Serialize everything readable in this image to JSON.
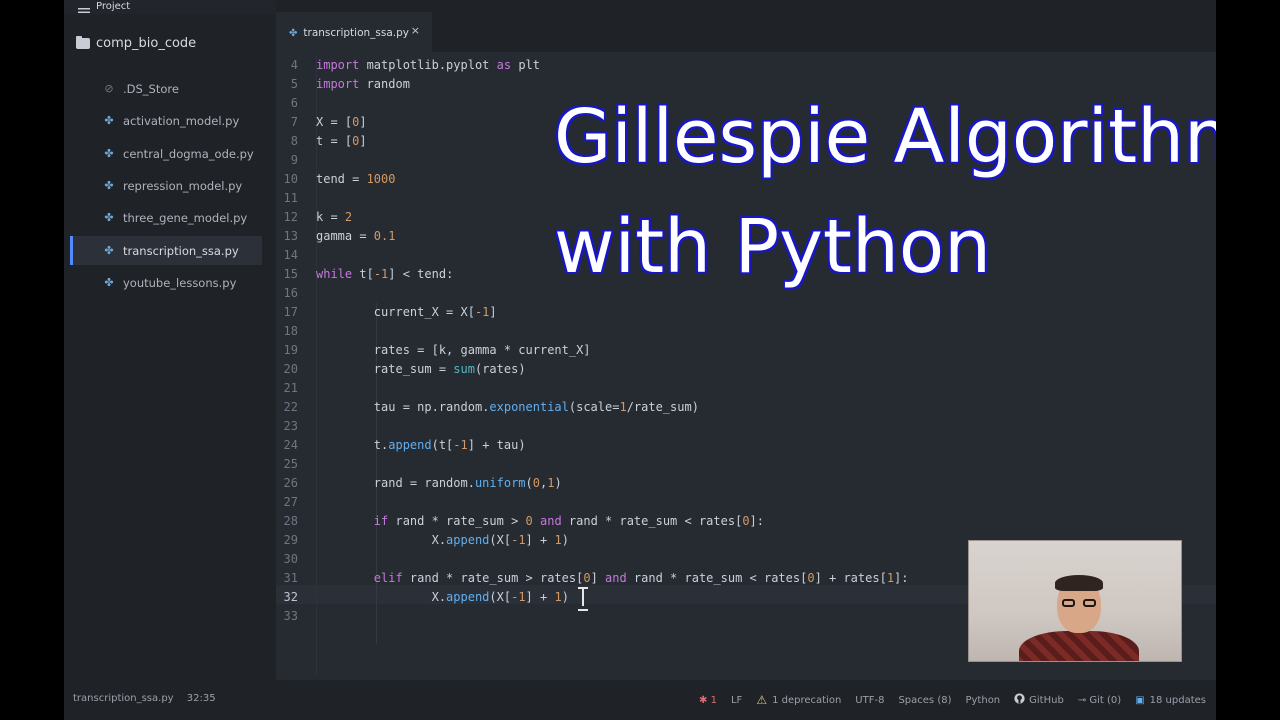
{
  "project_bar": {
    "label": "Project"
  },
  "sidebar": {
    "root": "comp_bio_code",
    "items": [
      {
        "label": ".DS_Store",
        "type": "ds",
        "selected": false
      },
      {
        "label": "activation_model.py",
        "type": "py",
        "selected": false
      },
      {
        "label": "central_dogma_ode.py",
        "type": "py",
        "selected": false
      },
      {
        "label": "repression_model.py",
        "type": "py",
        "selected": false
      },
      {
        "label": "three_gene_model.py",
        "type": "py",
        "selected": false
      },
      {
        "label": "transcription_ssa.py",
        "type": "py",
        "selected": true
      },
      {
        "label": "youtube_lessons.py",
        "type": "py",
        "selected": false
      }
    ]
  },
  "tab": {
    "label": "transcription_ssa.py",
    "close": "×"
  },
  "code": {
    "line_numbers": [
      "4",
      "5",
      "6",
      "7",
      "8",
      "9",
      "10",
      "11",
      "12",
      "13",
      "14",
      "15",
      "16",
      "17",
      "18",
      "19",
      "20",
      "21",
      "22",
      "23",
      "24",
      "25",
      "26",
      "27",
      "28",
      "29",
      "30",
      "31",
      "32",
      "33"
    ],
    "current_line": "32"
  },
  "overlay": {
    "line1": "Gillespie Algorithm",
    "line2": "with Python"
  },
  "status": {
    "file": "transcription_ssa.py",
    "position": "32:35",
    "bug_count": "1",
    "line_ending": "LF",
    "deprecation": "1 deprecation",
    "encoding": "UTF-8",
    "indent": "Spaces (8)",
    "grammar": "Python",
    "github": "GitHub",
    "git": "Git (0)",
    "updates": "18 updates"
  },
  "colors": {
    "accent": "#528bff",
    "overlay_outline": "#1717c8",
    "keyword": "#c678dd",
    "number": "#d19a66",
    "function": "#61afef"
  }
}
